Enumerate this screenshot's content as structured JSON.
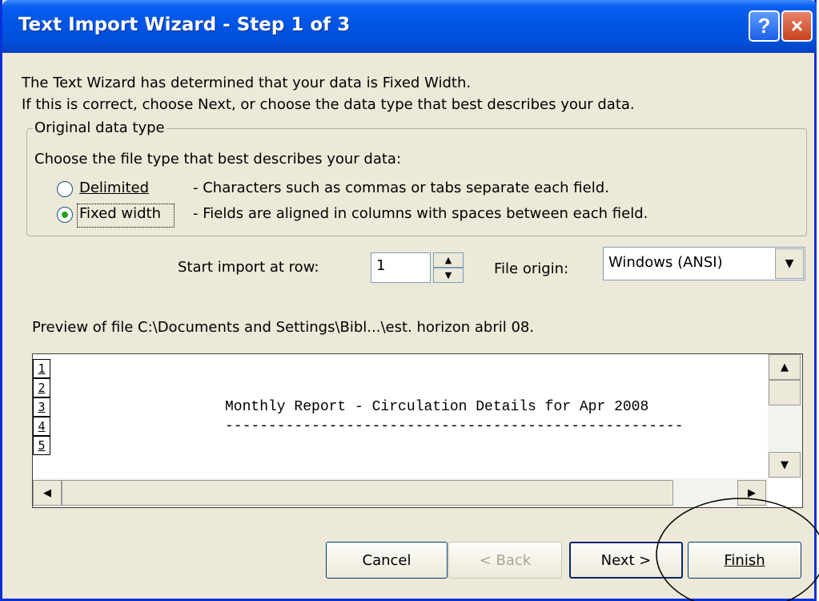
{
  "window": {
    "title": "Text Import Wizard - Step 1 of 3",
    "help_label": "?",
    "close_label": "×"
  },
  "intro": {
    "line1": "The Text Wizard has determined that your data is Fixed Width.",
    "line2": "If this is correct, choose Next, or choose the data type that best describes your data."
  },
  "group": {
    "label": "Original data type",
    "prompt": "Choose the file type that best describes your data:",
    "options": [
      {
        "label": "Delimited",
        "description": "- Characters such as commas or tabs separate each field.",
        "checked": false
      },
      {
        "label": "Fixed width",
        "description": "- Fields are aligned in columns with spaces between each field.",
        "checked": true
      }
    ]
  },
  "start_row": {
    "label": "Start import at row:",
    "value": "1"
  },
  "file_origin": {
    "label": "File origin:",
    "value": "Windows (ANSI)"
  },
  "preview": {
    "label": "Preview of file C:\\Documents and Settings\\Bibl...\\est. horizon abril 08.",
    "rows": [
      {
        "num": "1",
        "text": ""
      },
      {
        "num": "2",
        "text": ""
      },
      {
        "num": "3",
        "text": "Monthly Report - Circulation Details for Apr 2008"
      },
      {
        "num": "4",
        "text": "-----------------------------------------------------"
      },
      {
        "num": "5",
        "text": ""
      }
    ]
  },
  "buttons": {
    "cancel": "Cancel",
    "back": "< Back",
    "next": "Next >",
    "finish": "Finish"
  }
}
